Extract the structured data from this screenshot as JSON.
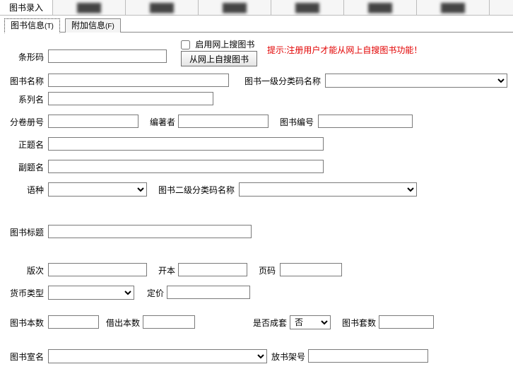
{
  "topbar": {
    "active": "图书录入",
    "blurred": [
      "",
      "",
      "",
      "",
      "",
      ""
    ]
  },
  "tabs": {
    "t1": "图书信息",
    "t1key": "(T)",
    "t2": "附加信息",
    "t2key": "(F)"
  },
  "checkbox_enable": "启用网上搜图书",
  "btn_search": "从网上自搜图书",
  "hint": "提示:注册用户才能从网上自搜图书功能！",
  "labels": {
    "barcode": "条形码",
    "bookname": "图书名称",
    "cat1": "图书一级分类码名称",
    "series": "系列名",
    "volno": "分卷册号",
    "author": "编著者",
    "bookno": "图书编号",
    "title_proper": "正题名",
    "subtitle": "副题名",
    "language": "语种",
    "cat2": "图书二级分类码名称",
    "booktitle": "图书标题",
    "edition": "版次",
    "format": "开本",
    "pages": "页码",
    "currency": "货币类型",
    "price": "定价",
    "copies": "图书本数",
    "lent": "借出本数",
    "isset": "是否成套",
    "setcount": "图书套数",
    "room": "图书室名",
    "shelf": "放书架号"
  },
  "values": {
    "barcode": "",
    "bookname": "",
    "cat1": "",
    "series": "",
    "volno": "",
    "author": "",
    "bookno": "",
    "title_proper": "",
    "subtitle": "",
    "language": "",
    "cat2": "",
    "booktitle": "",
    "edition": "",
    "format": "",
    "pages": "",
    "currency": "",
    "price": "",
    "copies": "",
    "lent": "",
    "isset": "否",
    "setcount": "",
    "room": "",
    "shelf": ""
  }
}
